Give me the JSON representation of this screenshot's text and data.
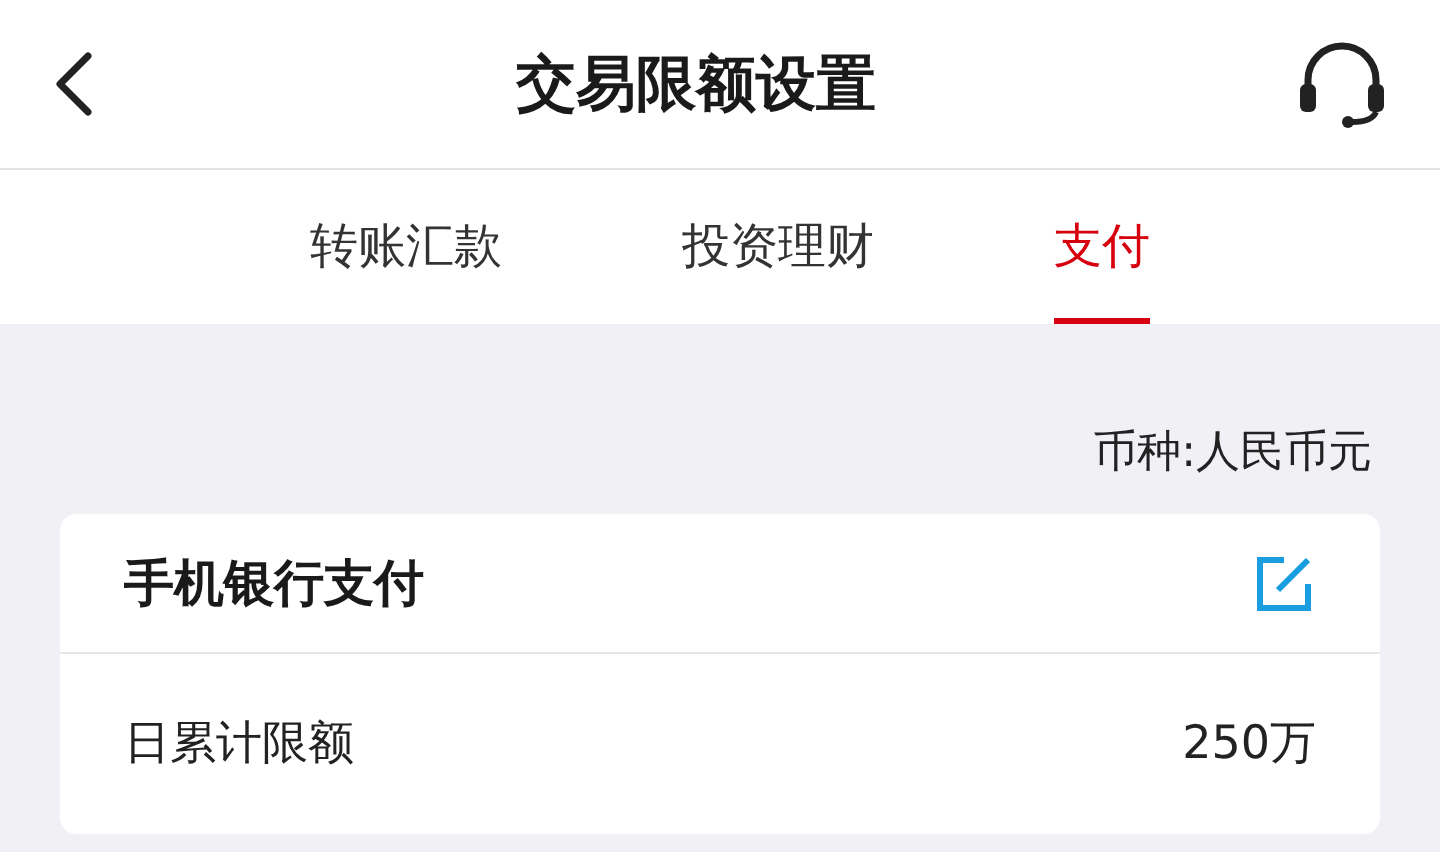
{
  "header": {
    "title": "交易限额设置"
  },
  "tabs": [
    {
      "label": "转账汇款",
      "selected": false
    },
    {
      "label": "投资理财",
      "selected": false
    },
    {
      "label": "支付",
      "selected": true
    }
  ],
  "currency": "币种:人民币元",
  "card": {
    "title": "手机银行支付",
    "rows": [
      {
        "label": "日累计限额",
        "value": "250万"
      }
    ]
  }
}
